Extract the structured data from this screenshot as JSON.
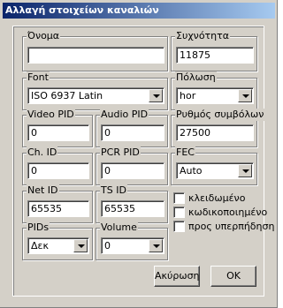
{
  "window": {
    "title": "Αλλαγή στοιχείων καναλιών"
  },
  "fields": {
    "name": {
      "label": "Όνομα",
      "value": ""
    },
    "frequency": {
      "label": "Συχνότητα",
      "value": "11875"
    },
    "font": {
      "label": "Font",
      "value": "ISO 6937 Latin"
    },
    "polarization": {
      "label": "Πόλωση",
      "value": "hor"
    },
    "video_pid": {
      "label": "Video PID",
      "value": "0"
    },
    "audio_pid": {
      "label": "Audio PID",
      "value": "0"
    },
    "symbol_rate": {
      "label": "Ρυθμός συμβόλων",
      "value": "27500"
    },
    "ch_id": {
      "label": "Ch. ID",
      "value": "0"
    },
    "pcr_pid": {
      "label": "PCR PID",
      "value": "0"
    },
    "fec": {
      "label": "FEC",
      "value": "Auto"
    },
    "net_id": {
      "label": "Net ID",
      "value": "65535"
    },
    "ts_id": {
      "label": "TS ID",
      "value": "65535"
    },
    "pids": {
      "label": "PIDs",
      "value": "Δεκ"
    },
    "volume": {
      "label": "Volume",
      "value": "0"
    }
  },
  "checkboxes": [
    {
      "label": "κλειδωμένο",
      "checked": false
    },
    {
      "label": "κωδικοποιημένο",
      "checked": false
    },
    {
      "label": "προς υπερπήδηση",
      "checked": false
    }
  ],
  "buttons": {
    "cancel": "Ακύρωση",
    "ok": "OK"
  }
}
